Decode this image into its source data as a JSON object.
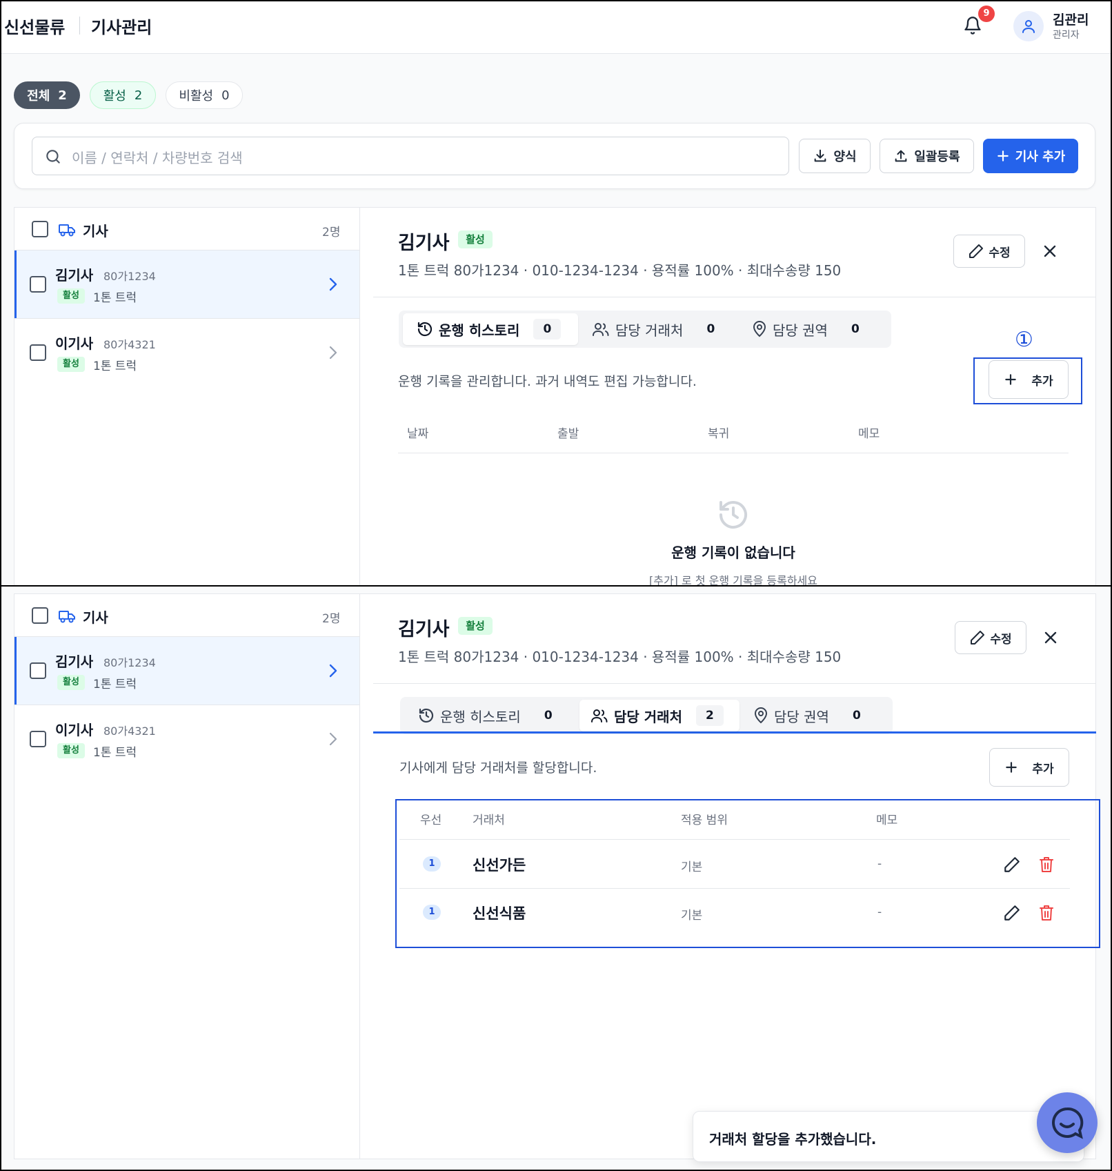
{
  "app": {
    "brand": "신선물류",
    "page_title": "기사관리"
  },
  "header": {
    "notification_count": "9",
    "user_name": "김관리",
    "user_role": "관리자"
  },
  "filters": [
    {
      "label": "전체",
      "count": "2"
    },
    {
      "label": "활성",
      "count": "2"
    },
    {
      "label": "비활성",
      "count": "0"
    }
  ],
  "search": {
    "placeholder": "이름 / 연락처 / 차량번호 검색"
  },
  "toolbar": {
    "template_label": "양식",
    "bulk_label": "일괄등록",
    "add_driver_label": "기사 추가"
  },
  "driver_list": {
    "title": "기사",
    "count": "2명",
    "drivers": [
      {
        "name": "김기사",
        "plate": "80가1234",
        "status": "활성",
        "vehicle": "1톤 트럭"
      },
      {
        "name": "이기사",
        "plate": "80가4321",
        "status": "활성",
        "vehicle": "1톤 트럭"
      }
    ]
  },
  "detail": {
    "name": "김기사",
    "status": "활성",
    "info": "1톤 트럭 80가1234 · 010-1234-1234 · 용적률 100% · 최대수송량 150",
    "edit_label": "수정",
    "tabs": [
      {
        "label": "운행 히스토리"
      },
      {
        "label": "담당 거래처"
      },
      {
        "label": "담당 권역"
      }
    ],
    "add_label": "추가"
  },
  "screen1": {
    "tab_counts": [
      "0",
      "0",
      "0"
    ],
    "description": "운행 기록을 관리합니다. 과거 내역도 편집 가능합니다.",
    "columns": [
      "날짜",
      "출발",
      "복귀",
      "메모"
    ],
    "empty_title": "운행 기록이 없습니다",
    "empty_subtitle": "[추가] 로 첫 운행 기록을 등록하세요",
    "annotation": "①"
  },
  "screen2": {
    "tab_counts": [
      "0",
      "2",
      "0"
    ],
    "description": "기사에게 담당 거래처를 할당합니다.",
    "columns": [
      "우선",
      "거래처",
      "적용 범위",
      "메모"
    ],
    "rows": [
      {
        "priority": "1",
        "client": "신선가든",
        "scope": "기본",
        "memo": "-"
      },
      {
        "priority": "1",
        "client": "신선식품",
        "scope": "기본",
        "memo": "-"
      }
    ],
    "toast": "거래처 할당을 추가했습니다."
  },
  "colors": {
    "accent": "#2563eb",
    "active_green": "#15803d",
    "danger": "#ef4444",
    "annotation": "#1d4ed8"
  }
}
